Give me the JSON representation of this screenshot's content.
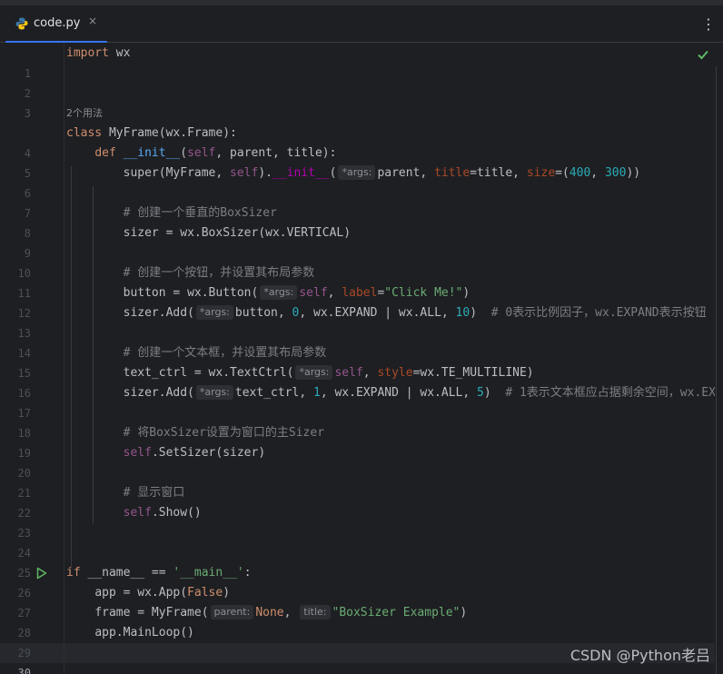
{
  "tab": {
    "filename": "code.py",
    "close_glyph": "×"
  },
  "toolbar": {
    "more_glyph": "⋮"
  },
  "usages_hint": "2个用法",
  "hints": {
    "args": "*args:",
    "parent": "parent:",
    "title": "title:"
  },
  "line_numbers": [
    "1",
    "2",
    "3",
    "4",
    "5",
    "6",
    "7",
    "8",
    "9",
    "10",
    "11",
    "12",
    "13",
    "14",
    "15",
    "16",
    "17",
    "18",
    "19",
    "20",
    "21",
    "22",
    "23",
    "24",
    "25",
    "26",
    "27",
    "28",
    "29",
    "30"
  ],
  "code": {
    "l1_kw": "import",
    "l1_rest": " wx",
    "l4_kw": "class",
    "l4_name": " MyFrame",
    "l4_rest": "(wx.Frame):",
    "l5_kw": "def",
    "l5_fn": " __init__",
    "l5_p1": "(",
    "l5_self": "self",
    "l5_rest": ", parent, title):",
    "l6_a": "super(MyFrame, ",
    "l6_self": "self",
    "l6_b": ").",
    "l6_init": "__init__",
    "l6_c": "(",
    "l6_d": "parent, ",
    "l6_kw1": "title",
    "l6_e": "=title, ",
    "l6_kw2": "size",
    "l6_f": "=(",
    "l6_n1": "400",
    "l6_g": ", ",
    "l6_n2": "300",
    "l6_h": "))",
    "l8_cmt": "# 创建一个垂直的BoxSizer",
    "l9": "sizer = wx.BoxSizer(wx.VERTICAL)",
    "l11_cmt": "# 创建一个按钮，并设置其布局参数",
    "l12_a": "button = wx.Button(",
    "l12_self": "self",
    "l12_b": ", ",
    "l12_kw": "label",
    "l12_c": "=",
    "l12_str": "\"Click Me!\"",
    "l12_d": ")",
    "l13_a": "sizer.Add(",
    "l13_b": "button, ",
    "l13_n1": "0",
    "l13_c": ", wx.EXPAND | wx.ALL, ",
    "l13_n2": "10",
    "l13_d": ")  ",
    "l13_cmt": "# 0表示比例因子，wx.EXPAND表示按钮",
    "l15_cmt": "# 创建一个文本框，并设置其布局参数",
    "l16_a": "text_ctrl = wx.TextCtrl(",
    "l16_self": "self",
    "l16_b": ", ",
    "l16_kw": "style",
    "l16_c": "=wx.TE_MULTILINE)",
    "l17_a": "sizer.Add(",
    "l17_b": "text_ctrl, ",
    "l17_n1": "1",
    "l17_c": ", wx.EXPAND | wx.ALL, ",
    "l17_n2": "5",
    "l17_d": ")  ",
    "l17_cmt": "# 1表示文本框应占据剩余空间，wx.EX",
    "l19_cmt": "# 将BoxSizer设置为窗口的主Sizer",
    "l20_self": "self",
    "l20_rest": ".SetSizer(sizer)",
    "l22_cmt": "# 显示窗口",
    "l23_self": "self",
    "l23_rest": ".Show()",
    "l26_kw": "if",
    "l26_a": " __name__ == ",
    "l26_str": "'__main__'",
    "l26_b": ":",
    "l27_a": "app = wx.App(",
    "l27_kw": "False",
    "l27_b": ")",
    "l28_a": "frame = MyFrame(",
    "l28_kw": "None",
    "l28_b": ", ",
    "l28_str": "\"BoxSizer Example\"",
    "l28_c": ")",
    "l29": "app.MainLoop()"
  },
  "watermark": "CSDN @Python老吕",
  "colors": {
    "background": "#1e1f22",
    "keyword": "#cf8e6d",
    "self": "#94558d",
    "number": "#2aacb8",
    "string": "#6aab73",
    "comment": "#7a7e85",
    "function": "#56a8f5",
    "accent": "#3574f0"
  },
  "icons": [
    "python-file-icon",
    "close-icon",
    "more-vertical-icon",
    "checkmark-icon",
    "run-icon"
  ]
}
